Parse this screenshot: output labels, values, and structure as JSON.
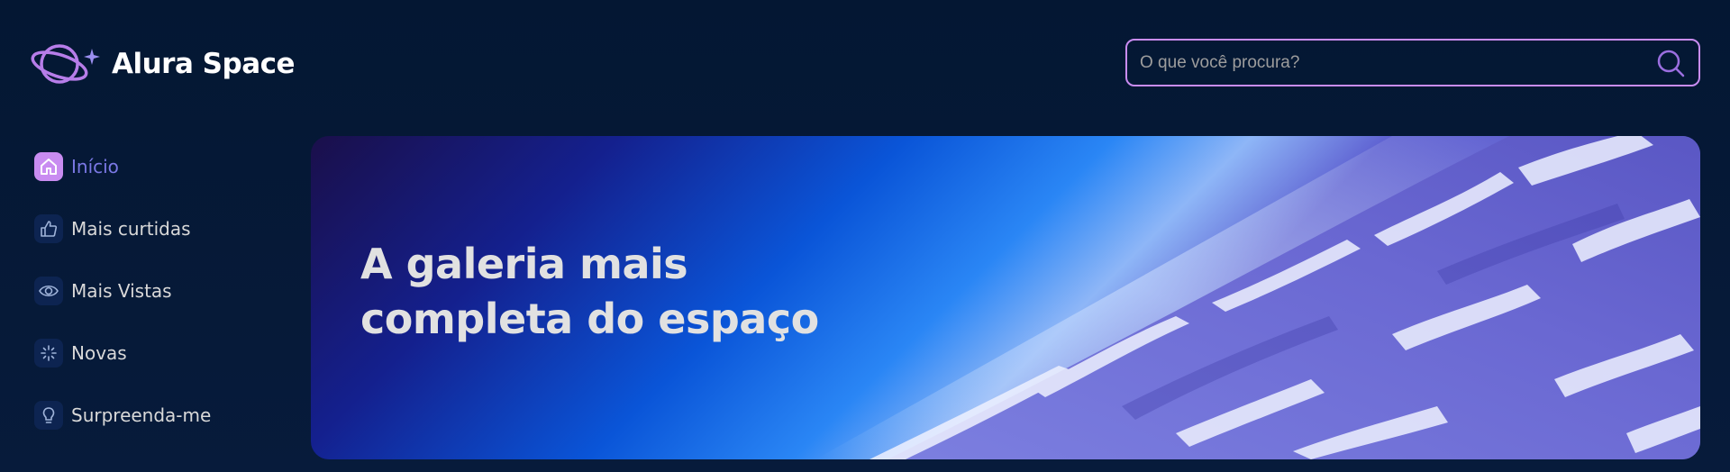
{
  "header": {
    "logo_text": "Alura Space",
    "search": {
      "placeholder": "O que você procura?",
      "value": ""
    }
  },
  "sidebar": {
    "items": [
      {
        "label": "Início",
        "icon": "home-icon",
        "active": true
      },
      {
        "label": "Mais curtidas",
        "icon": "thumbs-up-icon",
        "active": false
      },
      {
        "label": "Mais Vistas",
        "icon": "eye-icon",
        "active": false
      },
      {
        "label": "Novas",
        "icon": "sparkle-icon",
        "active": false
      },
      {
        "label": "Surpreenda-me",
        "icon": "lightbulb-icon",
        "active": false
      }
    ]
  },
  "banner": {
    "title": "A galeria mais completa do espaço"
  },
  "colors": {
    "background": "#041733",
    "accent": "#c98cf1",
    "active_text": "#7b78e5",
    "text": "#d9d9d9"
  }
}
